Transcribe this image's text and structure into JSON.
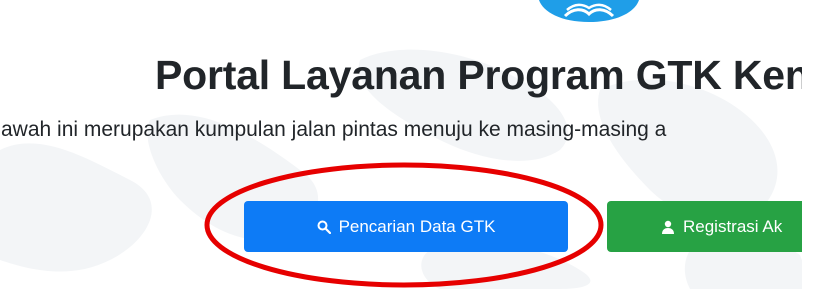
{
  "header": {
    "title": "Portal Layanan Program GTK Ken",
    "subtitle": "awah ini merupakan kumpulan jalan pintas menuju ke masing-masing a"
  },
  "actions": {
    "search_label": "Pencarian Data GTK",
    "register_label": "Registrasi Ak"
  },
  "icons": {
    "search": "search-icon",
    "user": "user-icon",
    "logo": "logo-emblem"
  },
  "colors": {
    "primary": "#0d7bf6",
    "success": "#27a244",
    "highlight": "#e60000",
    "logo": "#1f9ee8"
  }
}
